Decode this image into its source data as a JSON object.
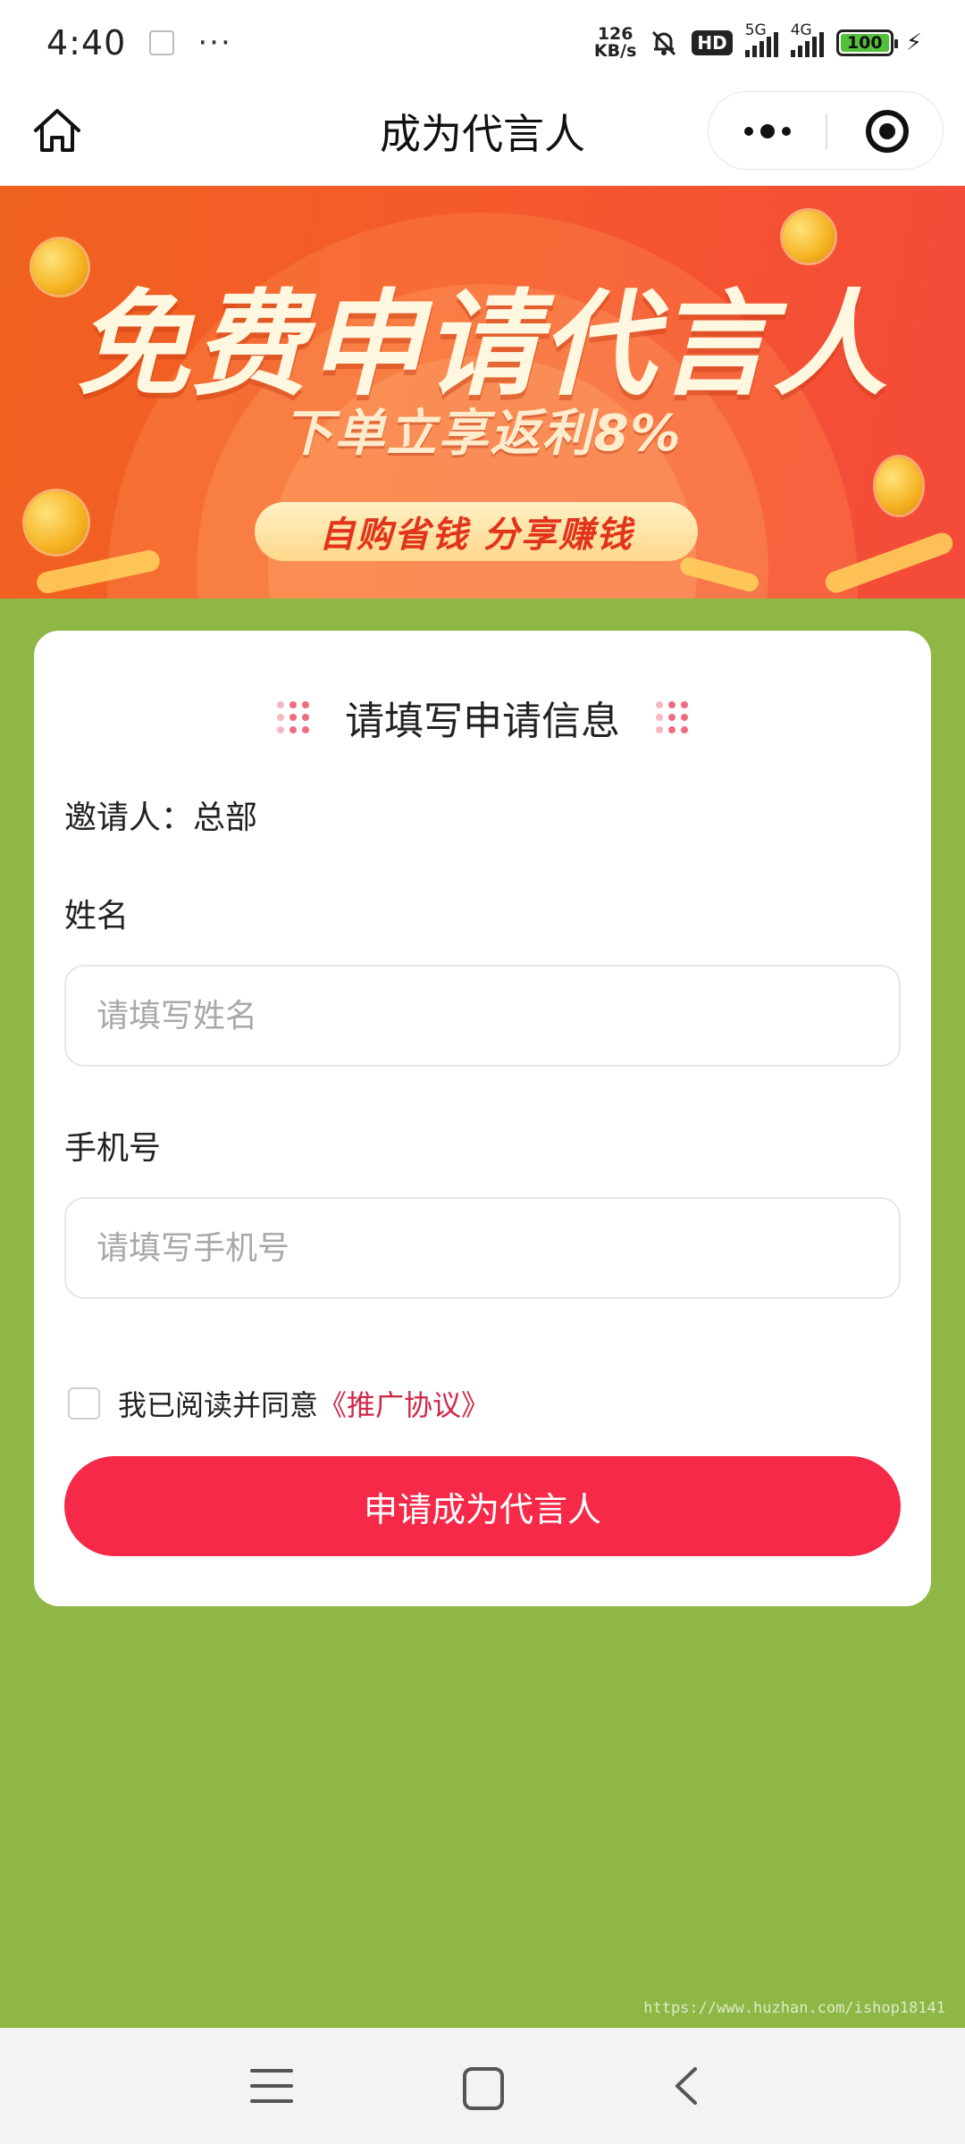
{
  "status_bar": {
    "time": "4:40",
    "dots": "···",
    "net_speed_value": "126",
    "net_speed_unit": "KB/s",
    "hd_label": "HD",
    "signal1_label": "5G",
    "signal2_label": "4G",
    "battery": "100"
  },
  "nav": {
    "title": "成为代言人"
  },
  "banner": {
    "headline": "免费申请代言人",
    "subheadline": "下单立享返利8%",
    "pill_text": "自购省钱 分享赚钱"
  },
  "form": {
    "title": "请填写申请信息",
    "inviter": "邀请人：总部",
    "name_label": "姓名",
    "name_placeholder": "请填写姓名",
    "phone_label": "手机号",
    "phone_placeholder": "请填写手机号",
    "agree_text": "我已阅读并同意",
    "agree_link": "《推广协议》",
    "submit_label": "申请成为代言人"
  },
  "watermark": "https://www.huzhan.com/ishop18141",
  "icons": [
    "home-icon",
    "more-icon",
    "target-icon",
    "menu-icon",
    "square-icon",
    "back-icon"
  ],
  "colors": {
    "background": "#8fb746",
    "primary_button": "#f62a48",
    "link": "#d02848"
  }
}
